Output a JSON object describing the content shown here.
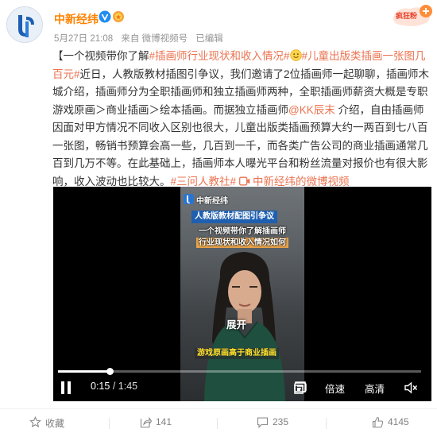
{
  "user": {
    "name": "中新经纬",
    "post_time": "5月27日 21:08",
    "source": "来自 微博视频号",
    "edited": "已编辑"
  },
  "post": {
    "intro": "【一个视频带你了解",
    "topic1": "#插画师行业现状和收入情况#",
    "topic2": "#儿童出版类插画一张图几百元#",
    "body1": "近日，人教版教材插图引争议，我们邀请了2位插画师一起聊聊，插画师木城介绍，插画师分为全职插画师和独立插画师两种，全职插画师薪资大概是专职游戏原画＞商业插画＞绘本插画。而据独立插画师",
    "mention": "@KK辰末",
    "body2": " 介绍，自由插画师因面对甲方情况不同收入区别也很大，儿童出版类插画预算大约一两百到七八百一张图，畅销书预算会高一些，几百到一千，而各类广告公司的商业插画通常几百到几万不等。在此基础上，插画师本人曝光平台和粉丝流量对报价也有很大影响，收入波动也比较大。",
    "topic3": "#三问人教社#",
    "video_link": "中新经纬的微博视频"
  },
  "video": {
    "watermark": "中新经纬",
    "tag_title": "人教版教材配图引争议",
    "subtitle_line1": "一个视频带你了解插画师",
    "subtitle_line2": "行业现状和收入情况如何",
    "expand_label": "展开",
    "caption": "游戏原画高于商业插画",
    "current_time": "0:15",
    "total_time": "1:45",
    "progress_fraction": 0.143,
    "speed_label": "倍速",
    "quality_label": "高清"
  },
  "actions": {
    "favorite_label": "收藏",
    "share_count": "141",
    "comment_count": "235",
    "like_count": "4145"
  },
  "colors": {
    "username": "#ff8200",
    "topic": "#eb7350",
    "action_text": "#808080"
  }
}
